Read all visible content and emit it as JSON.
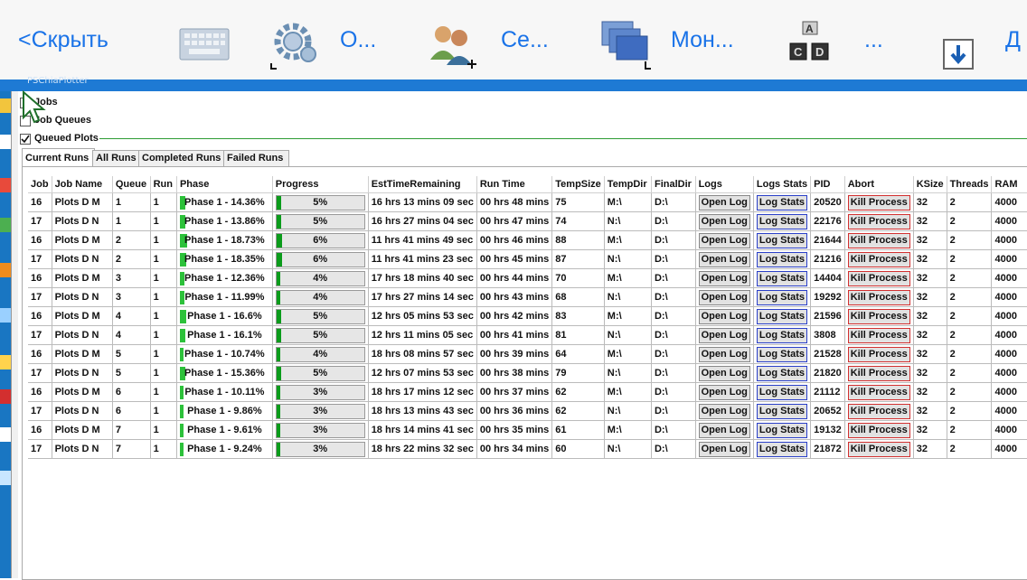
{
  "toolbar": {
    "hide_label": "<Скрыть",
    "item_options": "О...",
    "item_sessions": "Се...",
    "item_monitors": "Мон...",
    "item_more": "...",
    "item_more2": "Д"
  },
  "window": {
    "title": "PSChiaPlotter"
  },
  "sections": {
    "jobs": "Jobs",
    "job_queues": "Job Queues",
    "queued_plots": "Queued Plots"
  },
  "tabs": [
    "Current Runs",
    "All Runs",
    "Completed Runs",
    "Failed Runs"
  ],
  "columns": [
    "Job",
    "Job Name",
    "Queue",
    "Run",
    "Phase",
    "Progress",
    "EstTimeRemaining",
    "Run Time",
    "TempSize",
    "TempDir",
    "FinalDir",
    "Logs",
    "Logs Stats",
    "PID",
    "Abort",
    "KSize",
    "Threads",
    "RAM"
  ],
  "buttons": {
    "open_log": "Open Log",
    "log_stats": "Log Stats",
    "kill": "Kill Process"
  },
  "rows": [
    {
      "job": "16",
      "name": "Plots D M",
      "queue": "1",
      "run": "1",
      "phase": "Phase 1 - 14.36%",
      "phase_pct": 0.14,
      "progress": "5%",
      "progress_pct": 0.05,
      "est": "16 hrs 13 mins 09 sec",
      "runtime": "00 hrs 48 mins",
      "tempsize": "75",
      "tempdir": "M:\\",
      "finaldir": "D:\\",
      "pid": "20520",
      "ksize": "32",
      "threads": "2",
      "ram": "4000"
    },
    {
      "job": "17",
      "name": "Plots D N",
      "queue": "1",
      "run": "1",
      "phase": "Phase 1 - 13.86%",
      "phase_pct": 0.14,
      "progress": "5%",
      "progress_pct": 0.05,
      "est": "16 hrs 27 mins 04 sec",
      "runtime": "00 hrs 47 mins",
      "tempsize": "74",
      "tempdir": "N:\\",
      "finaldir": "D:\\",
      "pid": "22176",
      "ksize": "32",
      "threads": "2",
      "ram": "4000"
    },
    {
      "job": "16",
      "name": "Plots D M",
      "queue": "2",
      "run": "1",
      "phase": "Phase 1 - 18.73%",
      "phase_pct": 0.19,
      "progress": "6%",
      "progress_pct": 0.06,
      "est": "11 hrs 41 mins 49 sec",
      "runtime": "00 hrs 46 mins",
      "tempsize": "88",
      "tempdir": "M:\\",
      "finaldir": "D:\\",
      "pid": "21644",
      "ksize": "32",
      "threads": "2",
      "ram": "4000"
    },
    {
      "job": "17",
      "name": "Plots D N",
      "queue": "2",
      "run": "1",
      "phase": "Phase 1 - 18.35%",
      "phase_pct": 0.18,
      "progress": "6%",
      "progress_pct": 0.06,
      "est": "11 hrs 41 mins 23 sec",
      "runtime": "00 hrs 45 mins",
      "tempsize": "87",
      "tempdir": "N:\\",
      "finaldir": "D:\\",
      "pid": "21216",
      "ksize": "32",
      "threads": "2",
      "ram": "4000"
    },
    {
      "job": "16",
      "name": "Plots D M",
      "queue": "3",
      "run": "1",
      "phase": "Phase 1 - 12.36%",
      "phase_pct": 0.12,
      "progress": "4%",
      "progress_pct": 0.04,
      "est": "17 hrs 18 mins 40 sec",
      "runtime": "00 hrs 44 mins",
      "tempsize": "70",
      "tempdir": "M:\\",
      "finaldir": "D:\\",
      "pid": "14404",
      "ksize": "32",
      "threads": "2",
      "ram": "4000"
    },
    {
      "job": "17",
      "name": "Plots D N",
      "queue": "3",
      "run": "1",
      "phase": "Phase 1 - 11.99%",
      "phase_pct": 0.12,
      "progress": "4%",
      "progress_pct": 0.04,
      "est": "17 hrs 27 mins 14 sec",
      "runtime": "00 hrs 43 mins",
      "tempsize": "68",
      "tempdir": "N:\\",
      "finaldir": "D:\\",
      "pid": "19292",
      "ksize": "32",
      "threads": "2",
      "ram": "4000"
    },
    {
      "job": "16",
      "name": "Plots D M",
      "queue": "4",
      "run": "1",
      "phase": "Phase 1 - 16.6%",
      "phase_pct": 0.17,
      "progress": "5%",
      "progress_pct": 0.05,
      "est": "12 hrs 05 mins 53 sec",
      "runtime": "00 hrs 42 mins",
      "tempsize": "83",
      "tempdir": "M:\\",
      "finaldir": "D:\\",
      "pid": "21596",
      "ksize": "32",
      "threads": "2",
      "ram": "4000"
    },
    {
      "job": "17",
      "name": "Plots D N",
      "queue": "4",
      "run": "1",
      "phase": "Phase 1 - 16.1%",
      "phase_pct": 0.16,
      "progress": "5%",
      "progress_pct": 0.05,
      "est": "12 hrs 11 mins 05 sec",
      "runtime": "00 hrs 41 mins",
      "tempsize": "81",
      "tempdir": "N:\\",
      "finaldir": "D:\\",
      "pid": "3808",
      "ksize": "32",
      "threads": "2",
      "ram": "4000"
    },
    {
      "job": "16",
      "name": "Plots D M",
      "queue": "5",
      "run": "1",
      "phase": "Phase 1 - 10.74%",
      "phase_pct": 0.11,
      "progress": "4%",
      "progress_pct": 0.04,
      "est": "18 hrs 08 mins 57 sec",
      "runtime": "00 hrs 39 mins",
      "tempsize": "64",
      "tempdir": "M:\\",
      "finaldir": "D:\\",
      "pid": "21528",
      "ksize": "32",
      "threads": "2",
      "ram": "4000"
    },
    {
      "job": "17",
      "name": "Plots D N",
      "queue": "5",
      "run": "1",
      "phase": "Phase 1 - 15.36%",
      "phase_pct": 0.15,
      "progress": "5%",
      "progress_pct": 0.05,
      "est": "12 hrs 07 mins 53 sec",
      "runtime": "00 hrs 38 mins",
      "tempsize": "79",
      "tempdir": "N:\\",
      "finaldir": "D:\\",
      "pid": "21820",
      "ksize": "32",
      "threads": "2",
      "ram": "4000"
    },
    {
      "job": "16",
      "name": "Plots D M",
      "queue": "6",
      "run": "1",
      "phase": "Phase 1 - 10.11%",
      "phase_pct": 0.1,
      "progress": "3%",
      "progress_pct": 0.03,
      "est": "18 hrs 17 mins 12 sec",
      "runtime": "00 hrs 37 mins",
      "tempsize": "62",
      "tempdir": "M:\\",
      "finaldir": "D:\\",
      "pid": "21112",
      "ksize": "32",
      "threads": "2",
      "ram": "4000"
    },
    {
      "job": "17",
      "name": "Plots D N",
      "queue": "6",
      "run": "1",
      "phase": "Phase 1 - 9.86%",
      "phase_pct": 0.1,
      "progress": "3%",
      "progress_pct": 0.03,
      "est": "18 hrs 13 mins 43 sec",
      "runtime": "00 hrs 36 mins",
      "tempsize": "62",
      "tempdir": "N:\\",
      "finaldir": "D:\\",
      "pid": "20652",
      "ksize": "32",
      "threads": "2",
      "ram": "4000"
    },
    {
      "job": "16",
      "name": "Plots D M",
      "queue": "7",
      "run": "1",
      "phase": "Phase 1 - 9.61%",
      "phase_pct": 0.1,
      "progress": "3%",
      "progress_pct": 0.03,
      "est": "18 hrs 14 mins 41 sec",
      "runtime": "00 hrs 35 mins",
      "tempsize": "61",
      "tempdir": "M:\\",
      "finaldir": "D:\\",
      "pid": "19132",
      "ksize": "32",
      "threads": "2",
      "ram": "4000"
    },
    {
      "job": "17",
      "name": "Plots D N",
      "queue": "7",
      "run": "1",
      "phase": "Phase 1 - 9.24%",
      "phase_pct": 0.09,
      "progress": "3%",
      "progress_pct": 0.03,
      "est": "18 hrs 22 mins 32 sec",
      "runtime": "00 hrs 34 mins",
      "tempsize": "60",
      "tempdir": "N:\\",
      "finaldir": "D:\\",
      "pid": "21872",
      "ksize": "32",
      "threads": "2",
      "ram": "4000"
    }
  ],
  "colors": {
    "accent": "#1a73e8",
    "title_bar": "#1e7ad4",
    "phase_bar": "#2cc13a",
    "progress_bar": "#0b9c1b",
    "kill_border": "#d23030",
    "stats_border": "#2a3fc8"
  },
  "icons": [
    "keyboard-icon",
    "settings-gear-icon",
    "users-icon",
    "monitors-icon",
    "keys-icon",
    "download-icon"
  ]
}
